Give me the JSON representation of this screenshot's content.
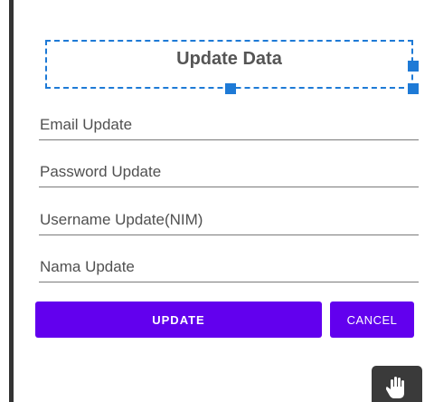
{
  "form": {
    "title": "Update Data",
    "fields": [
      {
        "placeholder": "Email Update"
      },
      {
        "placeholder": "Password Update"
      },
      {
        "placeholder": "Username Update(NIM)"
      },
      {
        "placeholder": "Nama Update"
      }
    ],
    "buttons": {
      "update_label": "UPDATE",
      "cancel_label": "CANCEL"
    }
  },
  "colors": {
    "primary": "#6200ee",
    "selection": "#1e7ad6",
    "tool_bg": "#3a3a3a"
  },
  "icons": {
    "pan_tool": "hand-icon"
  }
}
